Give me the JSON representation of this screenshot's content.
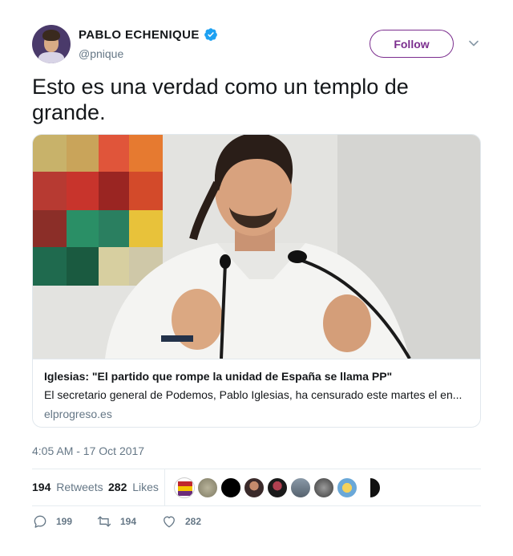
{
  "user": {
    "display_name": "PABLO ECHENIQUE",
    "handle": "@pnique",
    "verified": true,
    "verified_color": "#1da1f2"
  },
  "follow_button": {
    "label": "Follow",
    "color": "#7b2e8e"
  },
  "tweet": {
    "text": "Esto es una verdad como un templo de grande."
  },
  "card": {
    "title": "Iglesias: \"El partido que rompe la unidad de España se llama PP\"",
    "description": "El secretario general de Podemos, Pablo Iglesias, ha censurado este martes el en...",
    "domain": "elprogreso.es"
  },
  "timestamp": "4:05 AM - 17 Oct 2017",
  "stats": {
    "retweets_count": "194",
    "retweets_label": "Retweets",
    "likes_count": "282",
    "likes_label": "Likes",
    "likers": [
      "liker-1",
      "liker-2",
      "liker-3",
      "liker-4",
      "liker-5",
      "liker-6",
      "liker-7",
      "liker-8",
      "liker-9"
    ]
  },
  "actions": {
    "replies": "199",
    "retweets": "194",
    "likes": "282"
  }
}
